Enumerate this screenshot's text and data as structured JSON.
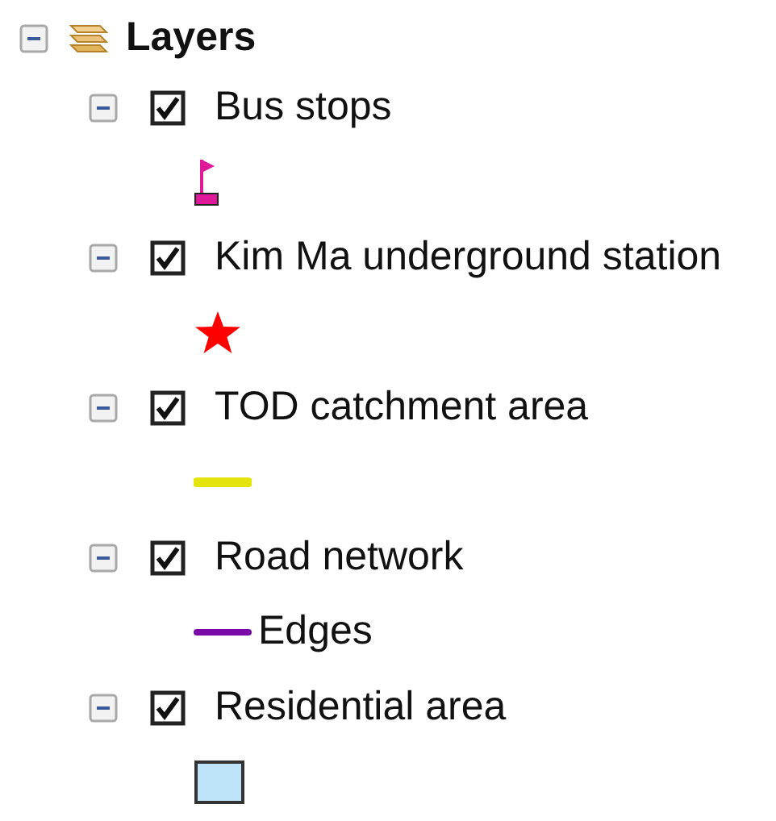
{
  "root": {
    "label": "Layers",
    "expanded": true
  },
  "layers": [
    {
      "name": "Bus stops",
      "expanded": true,
      "checked": true,
      "symbol": {
        "kind": "flag",
        "color": "#e0189a"
      }
    },
    {
      "name": "Kim Ma underground station",
      "expanded": true,
      "checked": true,
      "symbol": {
        "kind": "star",
        "color": "#ff0000"
      }
    },
    {
      "name": "TOD catchment area",
      "expanded": true,
      "checked": true,
      "symbol": {
        "kind": "line",
        "color": "#e4e40c"
      }
    },
    {
      "name": "Road network",
      "expanded": true,
      "checked": true,
      "symbol": {
        "kind": "line",
        "color": "#7a0aa8",
        "label": "Edges"
      }
    },
    {
      "name": "Residential area",
      "expanded": true,
      "checked": true,
      "symbol": {
        "kind": "fill",
        "color": "#bfe3f8"
      }
    }
  ]
}
